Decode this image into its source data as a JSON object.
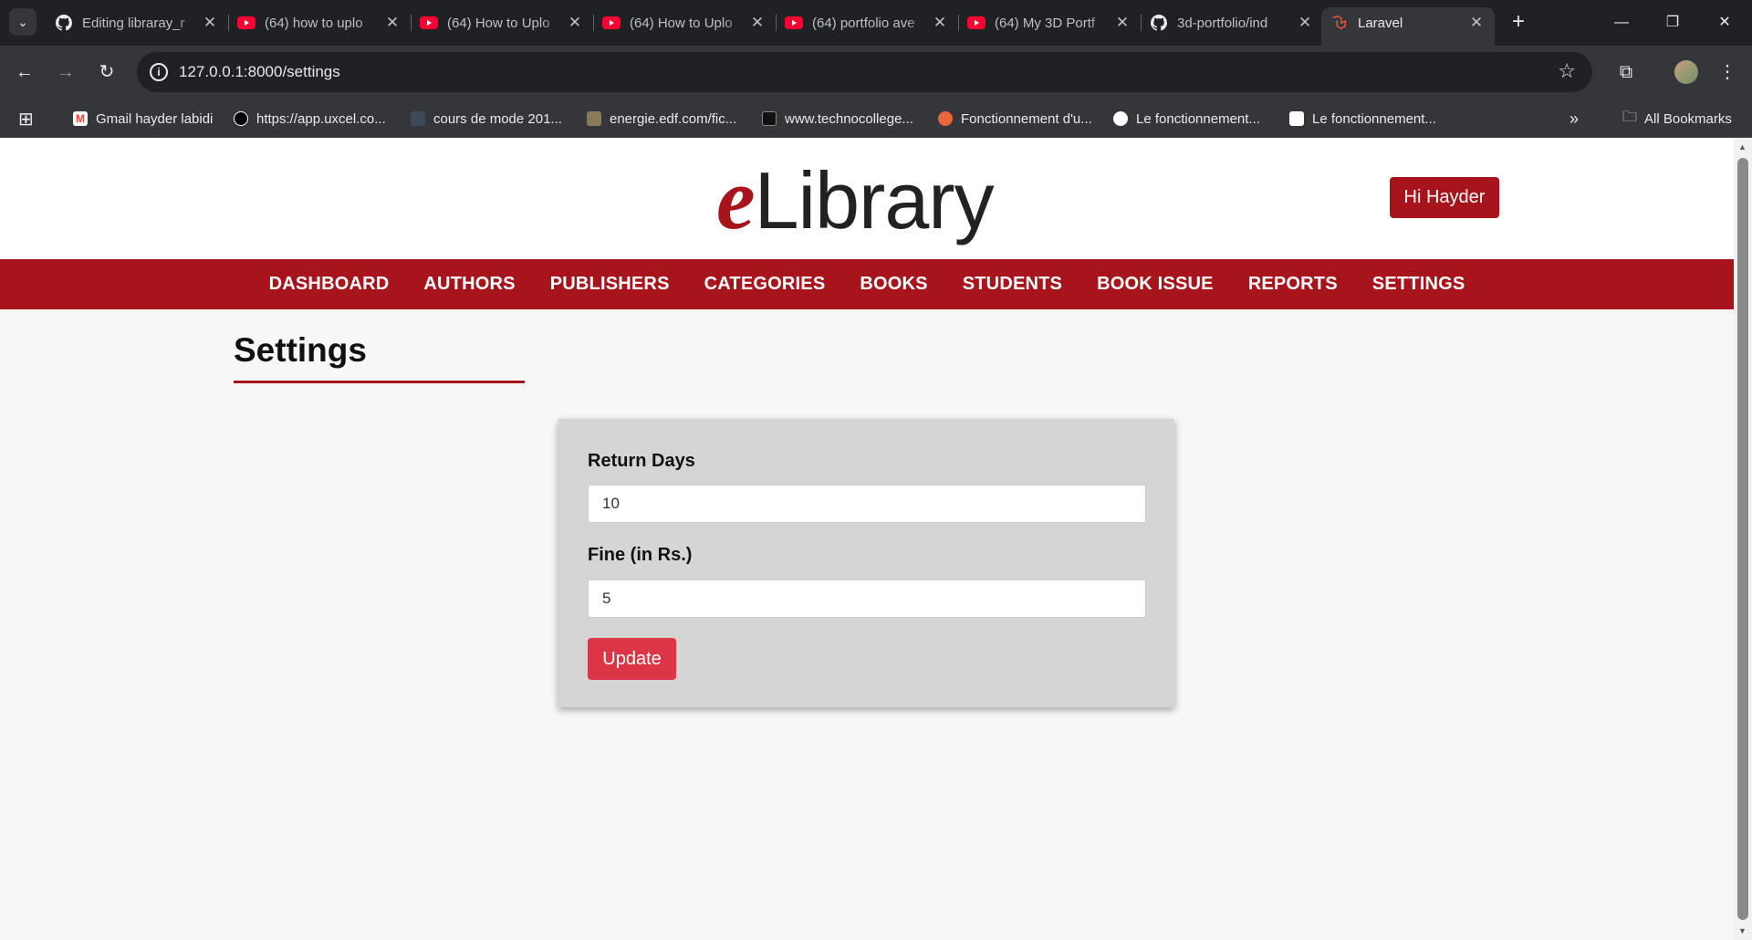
{
  "browser": {
    "tabs": [
      {
        "title": "Editing libraray_r",
        "icon": "github-icon"
      },
      {
        "title": "(64) how to uplo",
        "icon": "youtube-icon"
      },
      {
        "title": "(64) How to Uplo",
        "icon": "youtube-icon"
      },
      {
        "title": "(64) How to Uplo",
        "icon": "youtube-icon"
      },
      {
        "title": "(64) portfolio ave",
        "icon": "youtube-icon"
      },
      {
        "title": "(64) My 3D Portf",
        "icon": "youtube-icon"
      },
      {
        "title": "3d-portfolio/ind",
        "icon": "github-icon"
      },
      {
        "title": "Laravel",
        "icon": "laravel-icon"
      }
    ],
    "url": "127.0.0.1:8000/settings",
    "bookmarks": [
      "Gmail hayder labidi",
      "https://app.uxcel.co...",
      "cours de mode 201...",
      "energie.edf.com/fic...",
      "www.technocollege...",
      "Fonctionnement d'u...",
      "Le fonctionnement...",
      "Le fonctionnement..."
    ],
    "all_bookmarks": "All Bookmarks"
  },
  "app": {
    "logo_e": "e",
    "logo_rest": "Library",
    "greeting": "Hi Hayder",
    "brand_color": "#a8141b",
    "nav": [
      "DASHBOARD",
      "AUTHORS",
      "PUBLISHERS",
      "CATEGORIES",
      "BOOKS",
      "STUDENTS",
      "BOOK ISSUE",
      "REPORTS",
      "SETTINGS"
    ],
    "page_title": "Settings",
    "form": {
      "return_days_label": "Return Days",
      "return_days_value": "10",
      "fine_label": "Fine (in Rs.)",
      "fine_value": "5",
      "submit_label": "Update",
      "submit_color": "#dc3545"
    }
  }
}
